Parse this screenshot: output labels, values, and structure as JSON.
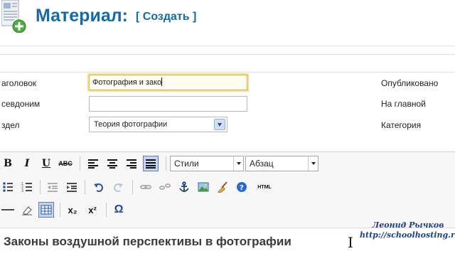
{
  "header": {
    "title": "Материал:",
    "subtitle": "[ Создать ]",
    "icon": "article-add-icon"
  },
  "form": {
    "title_label": "аголовок",
    "title_value": "Фотография и зако",
    "alias_label": "севдоним",
    "alias_value": "",
    "section_label": "здел",
    "section_value": "Теория фотографии",
    "published_label": "Опубликовано",
    "frontpage_label": "На главной",
    "category_label": "Категория"
  },
  "toolbar": {
    "row1": {
      "bold": "B",
      "italic": "I",
      "underline": "U",
      "strike": "ABC",
      "styles_value": "Стили",
      "format_value": "Абзац"
    },
    "row2": {
      "html_label": "HTML"
    },
    "row3": {
      "subscript": "x₂",
      "superscript": "x²",
      "omega": "Ω"
    }
  },
  "content": {
    "text": "Законы воздушной перспективы в фотографии"
  },
  "watermark": {
    "author": "Леонид Рычков",
    "url": "http://schoolhosting.ru"
  }
}
